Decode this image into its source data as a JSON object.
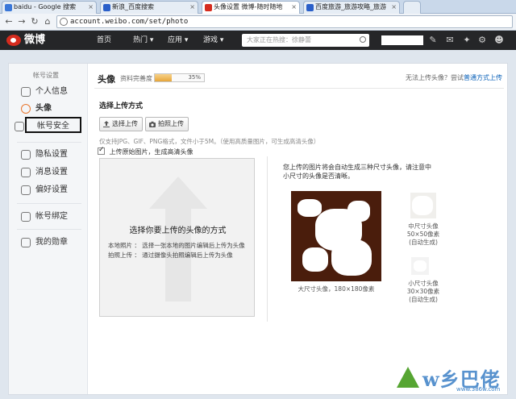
{
  "browser": {
    "tabs": [
      {
        "label": "baidu - Google 搜索",
        "icon_color": "#3a77d8"
      },
      {
        "label": "新浪_百度搜索",
        "icon_color": "#2a5fc9"
      },
      {
        "label": "头像设置 微博-随时随地",
        "icon_color": "#d52b1e"
      },
      {
        "label": "百度旅游_旅游攻略_旅游",
        "icon_color": "#2a5fc9"
      }
    ],
    "url": "account.weibo.com/set/photo"
  },
  "weibo_nav": {
    "logo_text": "微博",
    "links": [
      "首页",
      "热门 ▾",
      "应用 ▾",
      "游戏 ▾"
    ],
    "search_placeholder": "大家正在热搜：徐静蕾"
  },
  "sidebar": {
    "title": "帐号设置",
    "items": [
      {
        "label": "个人信息",
        "icon": "person-icon"
      },
      {
        "label": "头像",
        "icon": "avatar-icon"
      },
      {
        "label": "帐号安全",
        "icon": "shield-icon"
      },
      {
        "label": "隐私设置",
        "icon": "privacy-icon"
      },
      {
        "label": "消息设置",
        "icon": "message-icon"
      },
      {
        "label": "偏好设置",
        "icon": "preference-icon"
      },
      {
        "label": "帐号绑定",
        "icon": "bind-icon"
      },
      {
        "label": "我的勋章",
        "icon": "medal-icon"
      }
    ]
  },
  "main": {
    "section_title": "头像",
    "completeness_label": "资料完善度",
    "completeness_percent": "35%",
    "completeness_value": 0.35,
    "tip_text": "无法上传头像？尝试",
    "tip_link": "普通方式上传",
    "choose_title": "选择上传方式",
    "btn_select": "选择上传",
    "btn_photo": "拍照上传",
    "hint": "仅支持JPG、GIF、PNG格式，文件小于5M。（使用高质量图片，可生成高清头像）",
    "checkbox_label": "上传原始图片，生成高清头像",
    "upload_title": "选择你要上传的头像的方式",
    "upload_line1": "本地照片 ： 选择一张本地的图片编辑后上传为头像",
    "upload_line2": "拍照上传 ： 通过摄像头拍照编辑后上传为头像",
    "preview_text": "您上传的图片将会自动生成三种尺寸头像，请注意中小尺寸的头像是否清晰。",
    "cap_large": "大尺寸头像，180×180像素",
    "cap_mid_1": "中尺寸头像",
    "cap_mid_2": "50×50像素",
    "cap_mid_3": "(自动生成)",
    "cap_small_1": "小尺寸头像",
    "cap_small_2": "30×30像素",
    "cap_small_3": "(自动生成)"
  },
  "watermark": {
    "text": "w乡巴佬",
    "sub": "www.386w.com"
  },
  "colors": {
    "weibo_red": "#d52b1e",
    "nav_dark": "#252628",
    "link_blue": "#0a61b8",
    "progress": "#e7a63a"
  }
}
